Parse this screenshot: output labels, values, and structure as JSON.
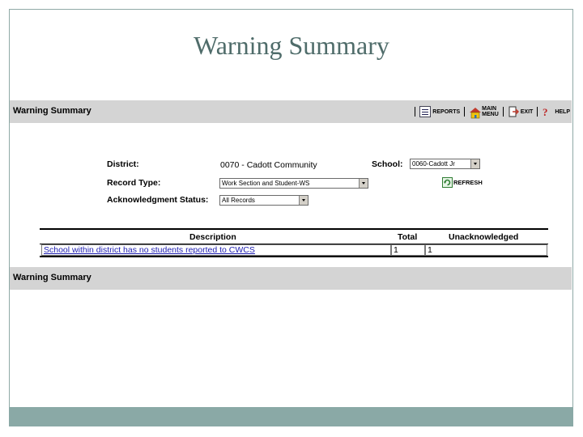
{
  "slide": {
    "title": "Warning Summary"
  },
  "header": {
    "title": "Warning Summary",
    "toolbar": {
      "reports_label": "REPORTS",
      "main_menu_line1": "MAIN",
      "main_menu_line2": "MENU",
      "exit_label": "EXIT",
      "help_label": "HELP"
    }
  },
  "form": {
    "district_label": "District:",
    "district_value": "0070 - Cadott Community",
    "school_label": "School:",
    "school_value": "0060-Cadott Jr",
    "record_type_label": "Record Type:",
    "record_type_value": "Work Section and Student-WS",
    "ack_status_label": "Acknowledgment Status:",
    "ack_status_value": "All Records",
    "refresh_label": "REFRESH"
  },
  "table": {
    "headers": {
      "description": "Description",
      "total": "Total",
      "unacknowledged": "Unacknowledged"
    },
    "rows": [
      {
        "description": "School within district has no students reported to CWCS",
        "total": "1",
        "unacknowledged": "1"
      }
    ]
  },
  "footer": {
    "title": "Warning Summary"
  },
  "colors": {
    "frame": "#8aa9a6",
    "bar": "#d4d4d4",
    "title": "#4f6c6a",
    "link": "#1d1db0"
  }
}
